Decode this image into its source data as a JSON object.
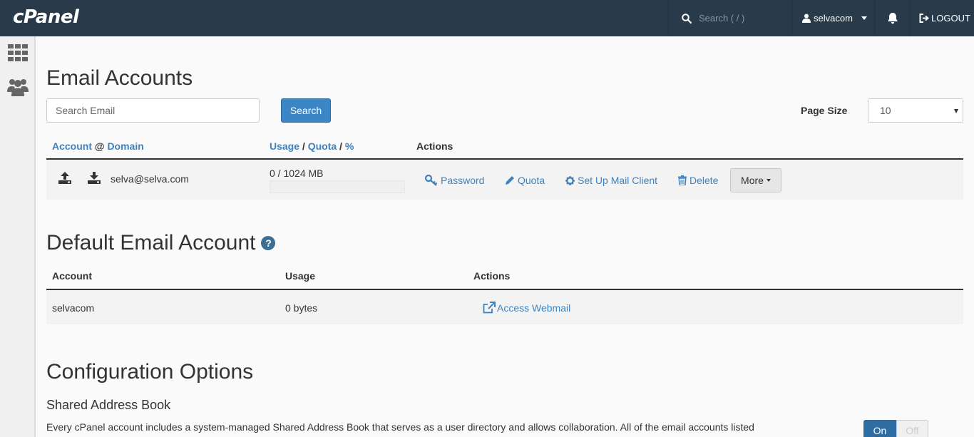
{
  "topbar": {
    "logo": "cPanel",
    "search_placeholder": "Search ( / )",
    "username": "selvacom",
    "logout_label": "LOGOUT"
  },
  "email_accounts": {
    "title": "Email Accounts",
    "search_placeholder": "Search Email",
    "search_button": "Search",
    "page_size_label": "Page Size",
    "page_size_value": "10",
    "headers": {
      "account": "Account",
      "at": "@",
      "domain": "Domain",
      "usage": "Usage",
      "slash1": "/",
      "quota": "Quota",
      "slash2": "/",
      "percent": "%",
      "actions": "Actions"
    },
    "rows": [
      {
        "email": "selva@selva.com",
        "usage_text": "0 / 1024 MB",
        "usage_fraction": 0,
        "actions": {
          "password": "Password",
          "quota": "Quota",
          "mail_client": "Set Up Mail Client",
          "delete": "Delete",
          "more": "More"
        }
      }
    ]
  },
  "default_account": {
    "title": "Default Email Account",
    "help_icon": "?",
    "headers": {
      "account": "Account",
      "usage": "Usage",
      "actions": "Actions"
    },
    "row": {
      "account": "selvacom",
      "usage": "0 bytes",
      "webmail": "Access Webmail"
    }
  },
  "config": {
    "title": "Configuration Options",
    "shared_title": "Shared Address Book",
    "shared_desc": "Every cPanel account includes a system-managed Shared Address Book that serves as a user directory and allows collaboration. All of the email accounts listed",
    "toggle_on": "On",
    "toggle_off": "Off"
  },
  "colors": {
    "topbar": "#293a4a",
    "link": "#3e82bf",
    "primary": "#3d86c6"
  }
}
